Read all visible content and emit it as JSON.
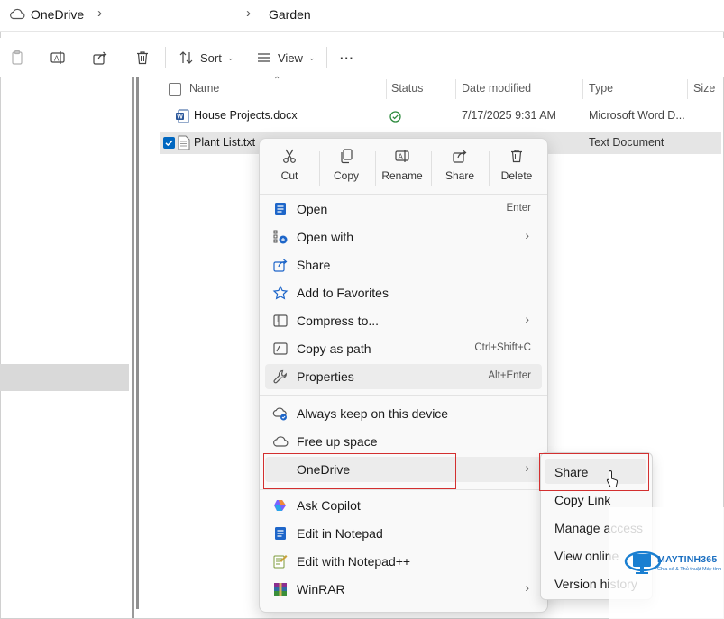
{
  "breadcrumb": {
    "root": "OneDrive",
    "current": "Garden"
  },
  "toolbar": {
    "sort_label": "Sort",
    "view_label": "View",
    "more_label": "···"
  },
  "columns": [
    "Name",
    "Status",
    "Date modified",
    "Type",
    "Size"
  ],
  "files": [
    {
      "name": "House Projects.docx",
      "status_icon": "synced-check-icon",
      "date": "7/17/2025 9:31 AM",
      "type": "Microsoft Word D...",
      "selected": false
    },
    {
      "name": "Plant List.txt",
      "status_icon": "",
      "date": "",
      "type": "Text Document",
      "selected": true
    }
  ],
  "context_menu": {
    "quick_actions": [
      "Cut",
      "Copy",
      "Rename",
      "Share",
      "Delete"
    ],
    "items": [
      {
        "label": "Open",
        "shortcut": "Enter",
        "icon": "notepad-icon"
      },
      {
        "label": "Open with",
        "arrow": true,
        "icon": "open-with-icon"
      },
      {
        "label": "Share",
        "icon": "share-icon"
      },
      {
        "label": "Add to Favorites",
        "icon": "star-icon"
      },
      {
        "label": "Compress to...",
        "arrow": true,
        "icon": "zip-folder-icon"
      },
      {
        "label": "Copy as path",
        "shortcut": "Ctrl+Shift+C",
        "icon": "copy-path-icon"
      },
      {
        "label": "Properties",
        "shortcut": "Alt+Enter",
        "icon": "wrench-icon"
      },
      {
        "label": "Always keep on this device",
        "icon": "cloud-sync-icon"
      },
      {
        "label": "Free up space",
        "icon": "cloud-icon"
      },
      {
        "label": "OneDrive",
        "arrow": true,
        "icon": ""
      },
      {
        "label": "Ask Copilot",
        "icon": "copilot-icon"
      },
      {
        "label": "Edit in Notepad",
        "icon": "notepad-icon"
      },
      {
        "label": "Edit with Notepad++",
        "icon": "notepadpp-icon"
      },
      {
        "label": "WinRAR",
        "arrow": true,
        "icon": "winrar-icon"
      }
    ]
  },
  "submenu": [
    "Share",
    "Copy Link",
    "Manage access",
    "View online",
    "Version history"
  ],
  "watermark": {
    "brand": "MAYTINH365",
    "tagline": "Chia sẻ & Thủ thuật Máy tính"
  },
  "colors": {
    "accent": "#0067c0",
    "highlight_box": "#d32f2f",
    "selection_row": "#e5e5e5"
  }
}
